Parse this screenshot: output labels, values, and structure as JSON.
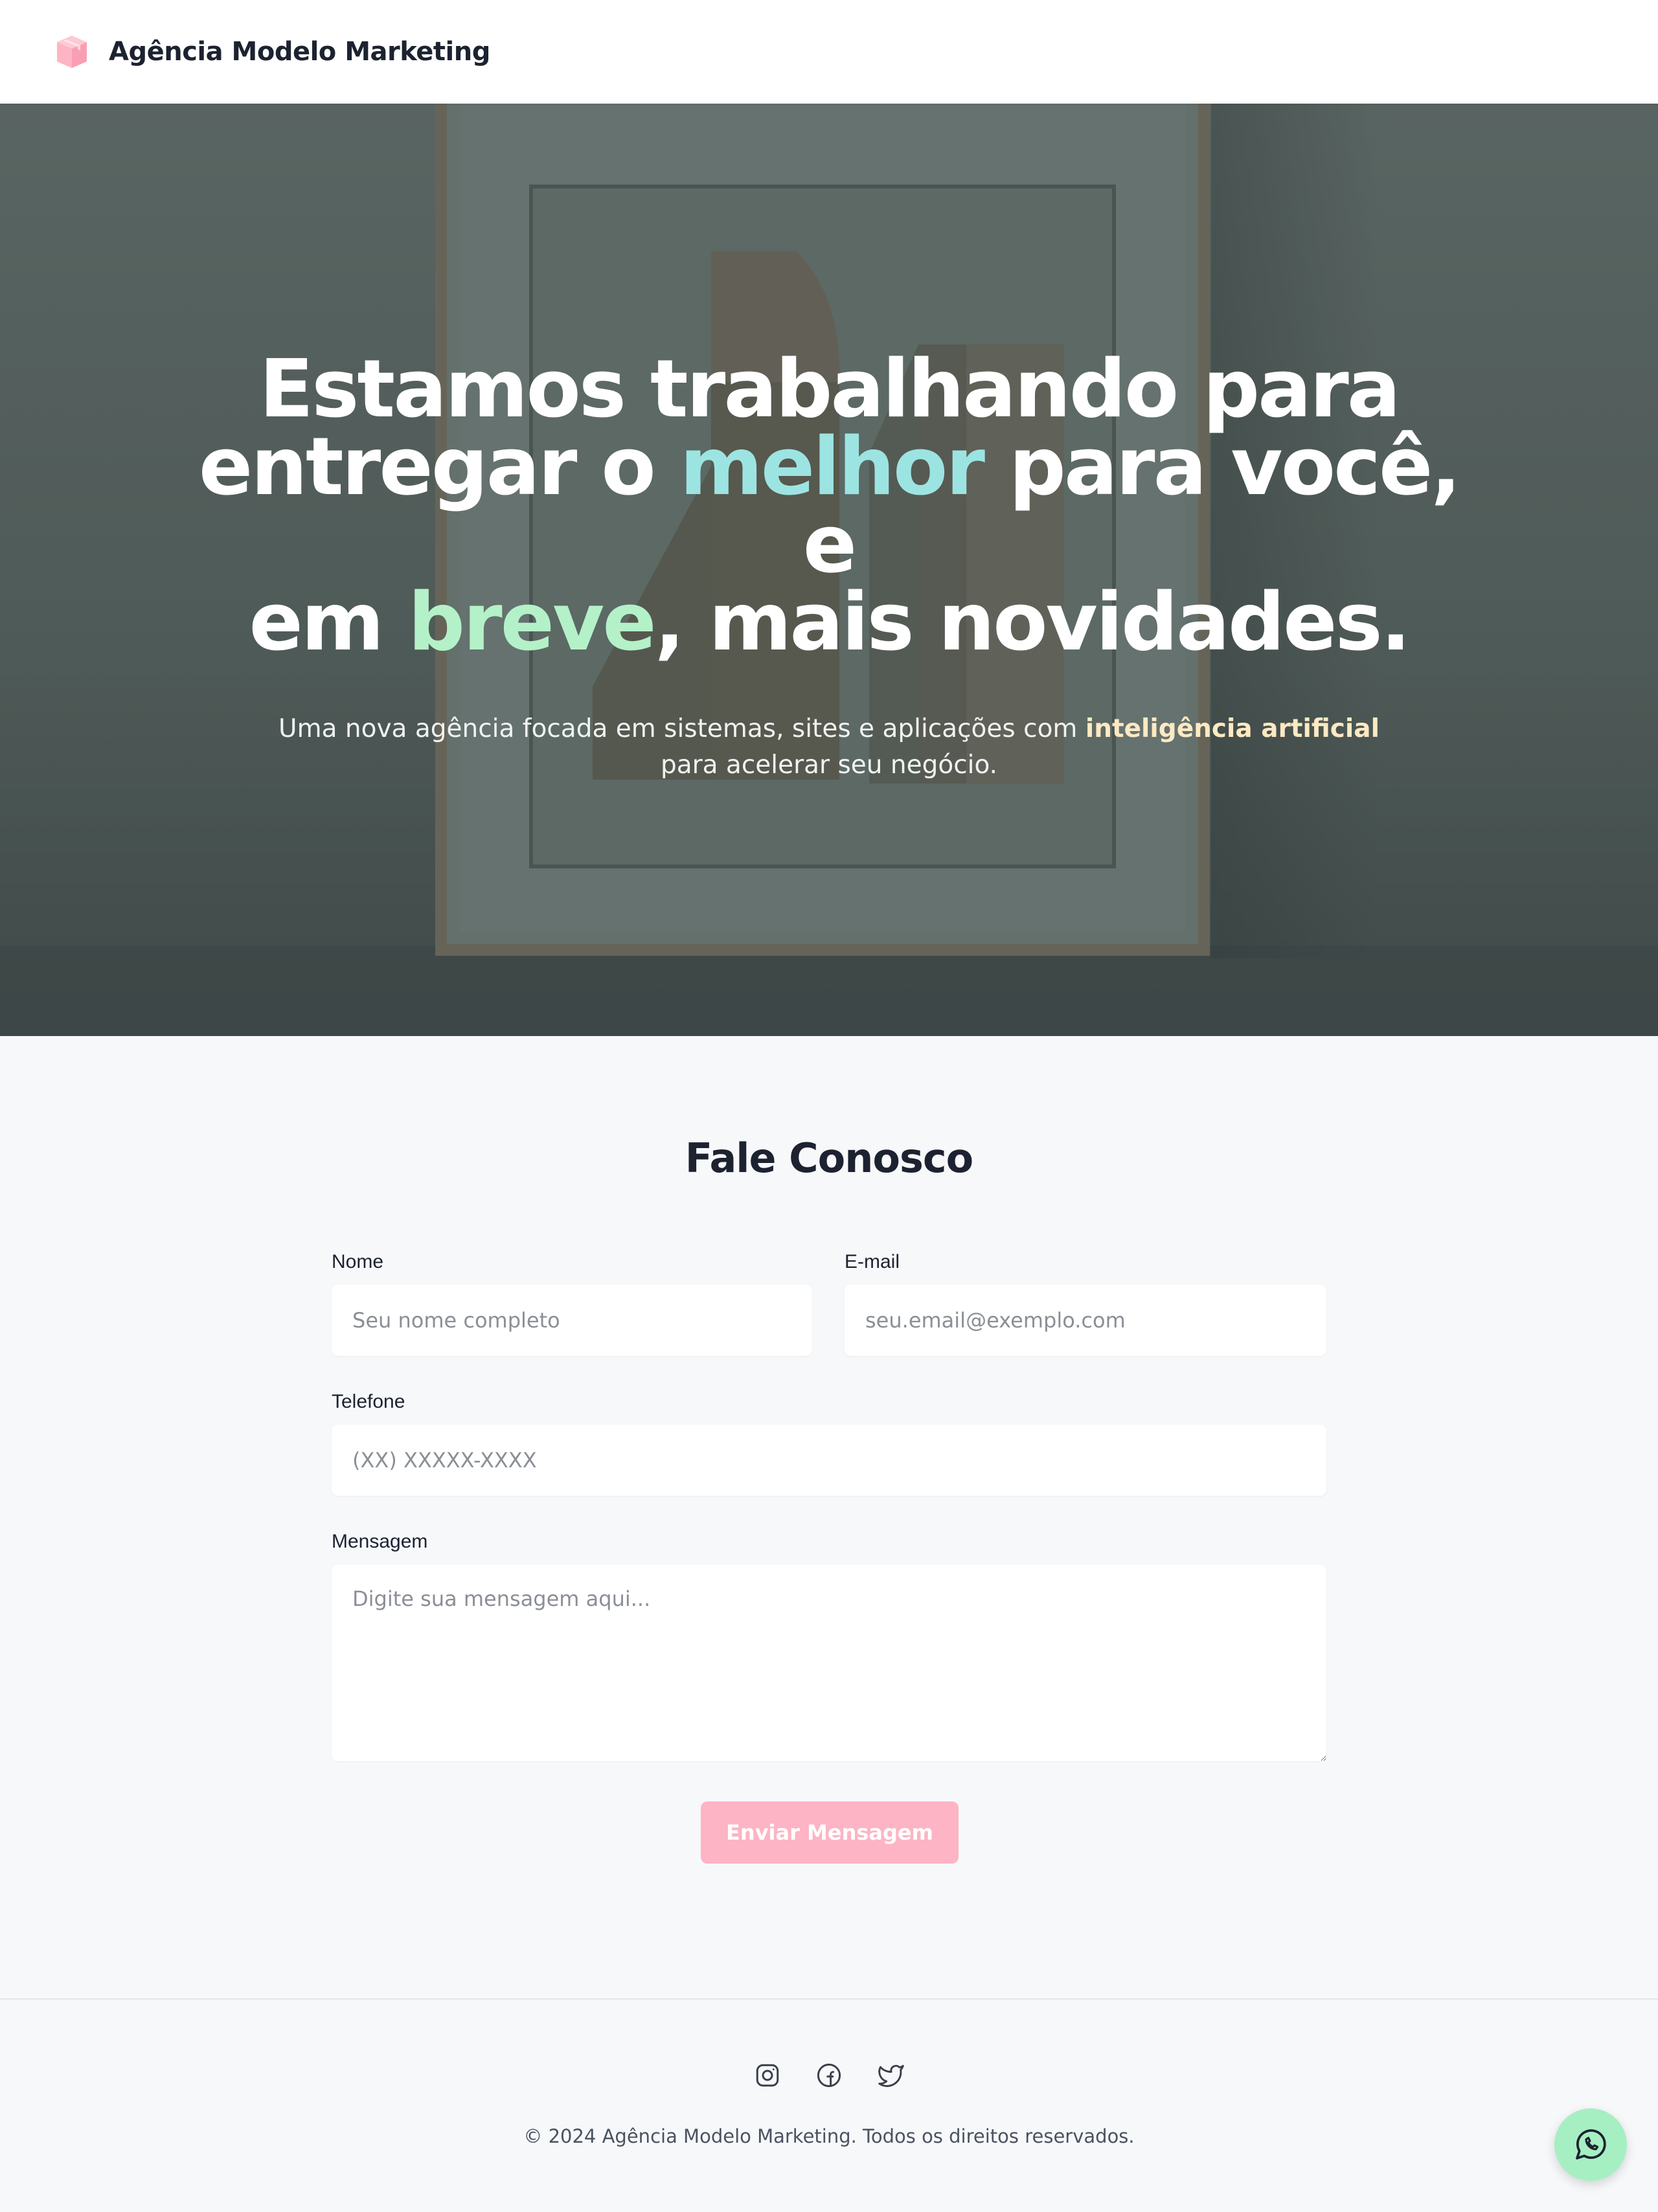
{
  "header": {
    "brand": "Agência Modelo Marketing",
    "logo_icon": "cube-icon",
    "logo_color": "#fdb4c4"
  },
  "hero": {
    "title": {
      "line1": "Estamos trabalhando para",
      "line2_before": "entregar o ",
      "line2_highlight": "melhor",
      "line2_after": " para você, e",
      "line3_before": "em ",
      "line3_highlight": "breve",
      "line3_after": ", mais novidades."
    },
    "subtitle_before": "Uma nova agência focada em sistemas, sites e aplicações com ",
    "subtitle_highlight": "inteligência artificial",
    "subtitle_after": " para acelerar seu negócio.",
    "colors": {
      "highlight_cyan": "#9ce4e2",
      "highlight_green": "#b4f1c8",
      "highlight_yellow": "#fde9c2"
    }
  },
  "contact": {
    "title": "Fale Conosco",
    "fields": {
      "name": {
        "label": "Nome",
        "placeholder": "Seu nome completo",
        "value": ""
      },
      "email": {
        "label": "E-mail",
        "placeholder": "seu.email@exemplo.com",
        "value": ""
      },
      "phone": {
        "label": "Telefone",
        "placeholder": "(XX) XXXXX-XXXX",
        "value": ""
      },
      "message": {
        "label": "Mensagem",
        "placeholder": "Digite sua mensagem aqui...",
        "value": ""
      }
    },
    "submit_label": "Enviar Mensagem",
    "submit_color": "#fdb4c4"
  },
  "footer": {
    "social": [
      "instagram-icon",
      "facebook-icon",
      "twitter-icon"
    ],
    "copyright": "© 2024 Agência Modelo Marketing. Todos os direitos reservados."
  },
  "floating": {
    "icon": "whatsapp-icon",
    "color": "#a6efc2"
  }
}
